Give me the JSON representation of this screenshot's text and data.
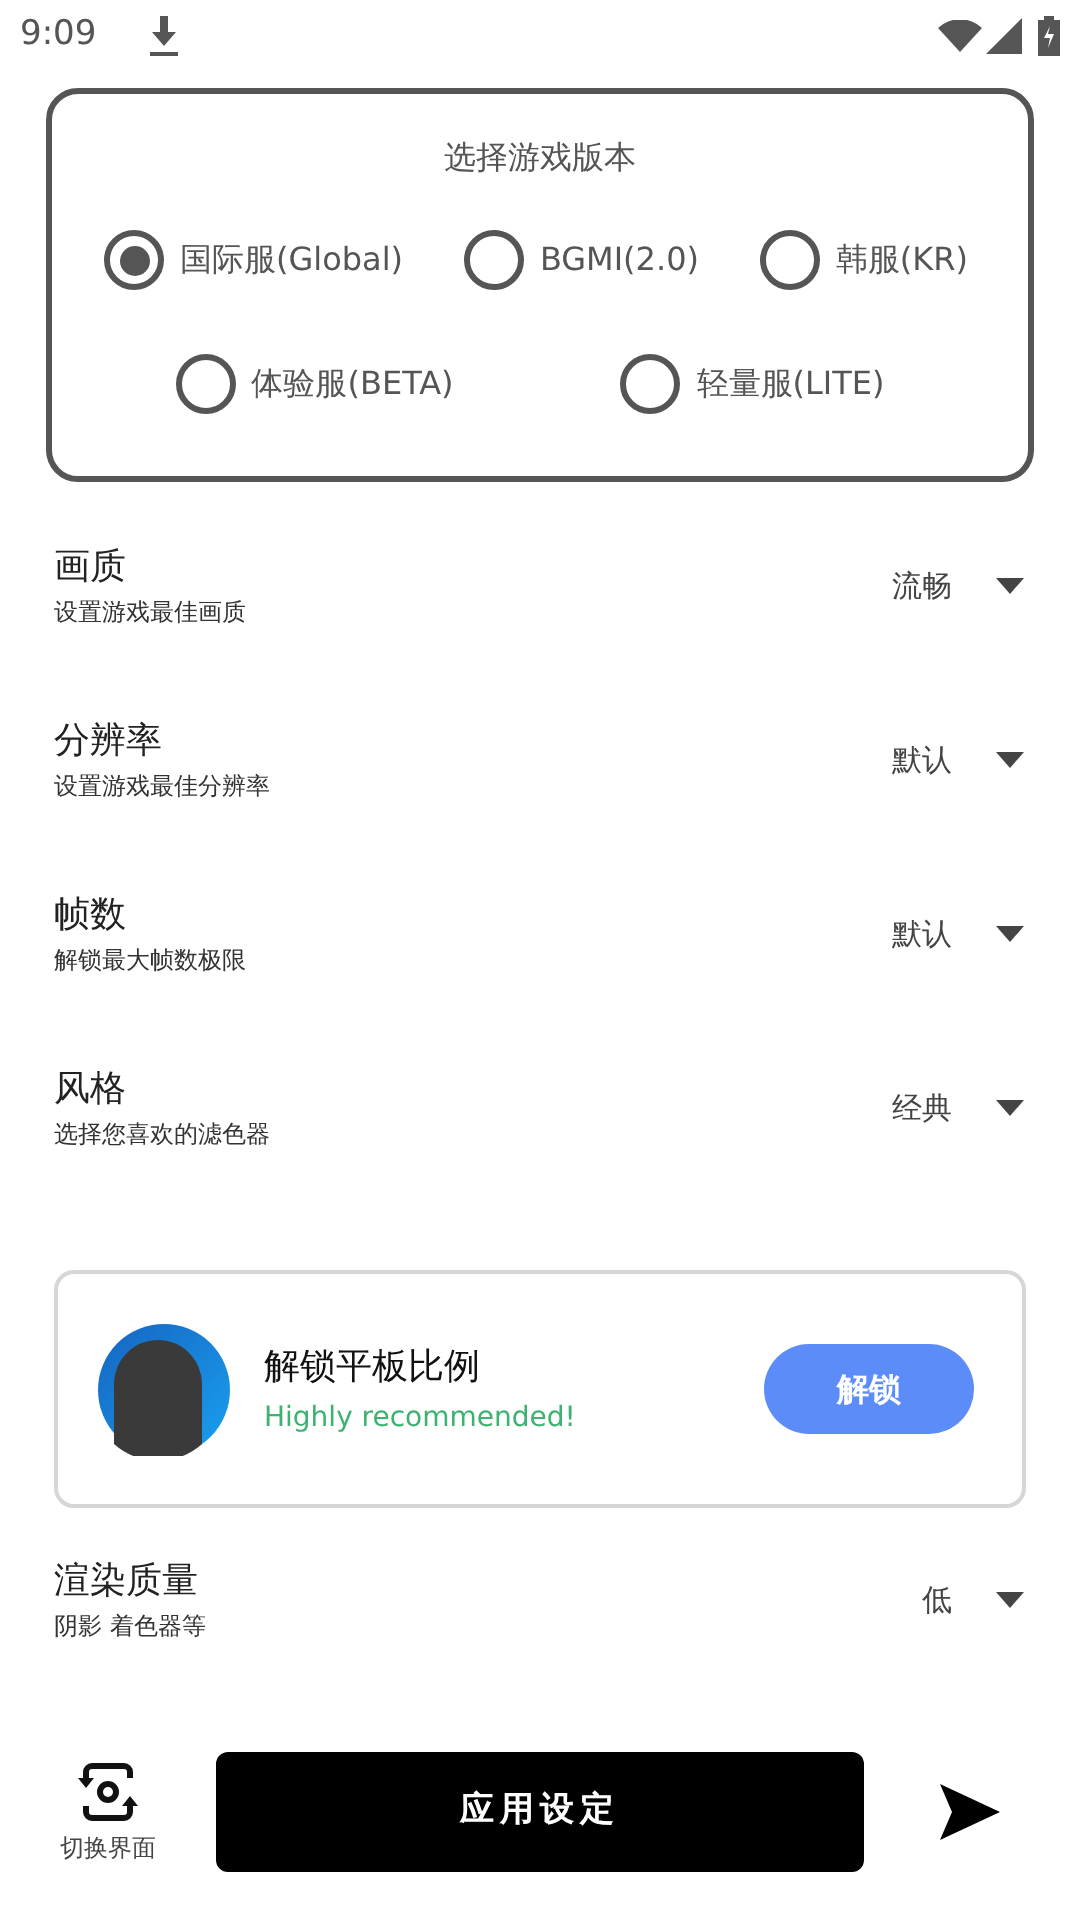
{
  "status_bar": {
    "time": "9:09"
  },
  "version": {
    "title": "选择游戏版本",
    "rows": [
      [
        {
          "label": "国际服(Global)",
          "selected": true
        },
        {
          "label": "BGMI(2.0)",
          "selected": false
        },
        {
          "label": "韩服(KR)",
          "selected": false
        }
      ],
      [
        {
          "label": "体验服(BETA)",
          "selected": false
        },
        {
          "label": "轻量服(LITE)",
          "selected": false
        }
      ]
    ]
  },
  "items": [
    {
      "kind": "setting",
      "title": "画质",
      "subtitle": "设置游戏最佳画质",
      "value": "流畅"
    },
    {
      "kind": "setting",
      "title": "分辨率",
      "subtitle": "设置游戏最佳分辨率",
      "value": "默认"
    },
    {
      "kind": "setting",
      "title": "帧数",
      "subtitle": "解锁最大帧数极限",
      "value": "默认"
    },
    {
      "kind": "setting",
      "title": "风格",
      "subtitle": "选择您喜欢的滤色器",
      "value": "经典"
    },
    {
      "kind": "promo",
      "title": "解锁平板比例",
      "subtitle": "Highly recommended!",
      "button": "解锁"
    },
    {
      "kind": "setting",
      "title": "渲染质量",
      "subtitle": "阴影 着色器等",
      "value": "低"
    }
  ],
  "bottom_bar": {
    "switch_label": "切换界面",
    "apply_button": "应用设定"
  }
}
